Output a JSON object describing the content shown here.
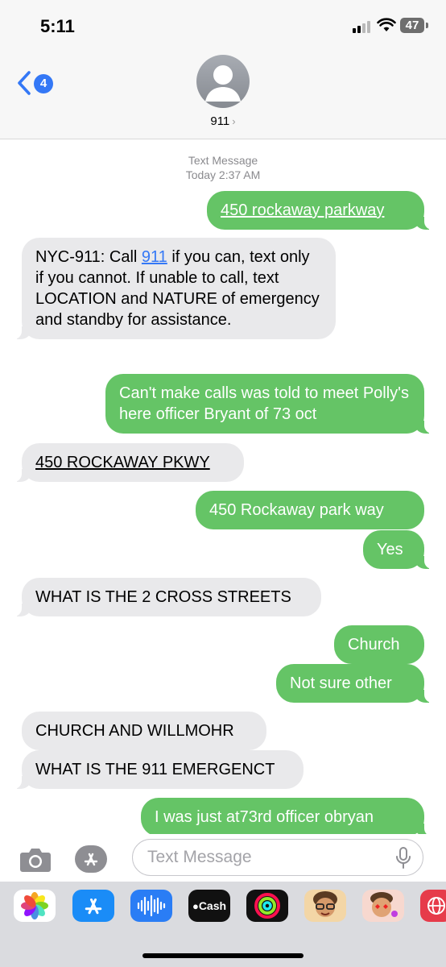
{
  "status_bar": {
    "time": "5:11",
    "battery": "47"
  },
  "header": {
    "back_badge": "4",
    "contact_name": "911"
  },
  "thread": {
    "timestamp_label": "Text Message",
    "timestamp_time": "Today 2:37 AM",
    "messages": [
      {
        "from": "me",
        "text": "450 rockaway parkway"
      },
      {
        "from": "them",
        "text_before": "NYC-911: Call ",
        "link": "911",
        "text_after": " if you can, text only if you cannot. If unable to call, text LOCATION and NATURE of emergency and standby for assistance."
      },
      {
        "from": "me",
        "text": "Can't make calls was told to meet Polly's here officer Bryant of 73 oct"
      },
      {
        "from": "them",
        "text": "450 ROCKAWAY PKWY"
      },
      {
        "from": "me",
        "text": "450 Rockaway park way"
      },
      {
        "from": "me",
        "text": "Yes"
      },
      {
        "from": "them",
        "text": "WHAT IS THE 2 CROSS STREETS"
      },
      {
        "from": "me",
        "text": "Church"
      },
      {
        "from": "me",
        "text": "Not sure other"
      },
      {
        "from": "them",
        "text": "CHURCH AND WILLMOHR"
      },
      {
        "from": "them",
        "text": "WHAT IS THE 911 EMERGENCT"
      },
      {
        "from": "me",
        "text": "I was just at73rd officer obryan"
      }
    ]
  },
  "composer": {
    "placeholder": "Text Message"
  },
  "app_drawer": {
    "apps": [
      {
        "name": "photos-app-icon",
        "label": ""
      },
      {
        "name": "app-store-app-icon",
        "label": ""
      },
      {
        "name": "audio-message-app-icon",
        "label": ""
      },
      {
        "name": "apple-cash-app-icon",
        "label": "Cash"
      },
      {
        "name": "activity-app-icon",
        "label": ""
      },
      {
        "name": "memoji-app-icon",
        "label": ""
      },
      {
        "name": "memoji-stickers-app-icon",
        "label": ""
      },
      {
        "name": "web-search-app-icon",
        "label": ""
      }
    ]
  },
  "colors": {
    "sent_bubble": "#65c466",
    "received_bubble": "#e9e9eb",
    "accent": "#3478f6"
  }
}
